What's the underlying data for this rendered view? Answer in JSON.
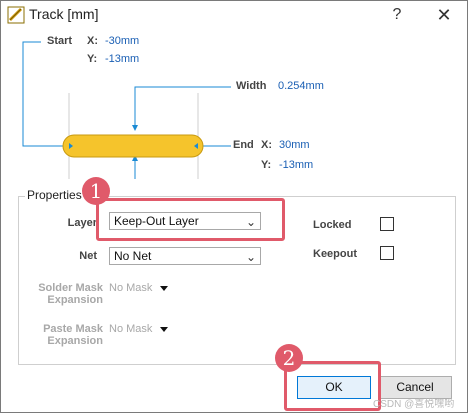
{
  "window": {
    "title": "Track [mm]",
    "help_glyph": "?",
    "close_glyph": "✕"
  },
  "diagram": {
    "start_label": "Start",
    "start_x_label": "X:",
    "start_x_value": "-30mm",
    "start_y_label": "Y:",
    "start_y_value": "-13mm",
    "width_label": "Width",
    "width_value": "0.254mm",
    "end_label": "End",
    "end_x_label": "X:",
    "end_x_value": "30mm",
    "end_y_label": "Y:",
    "end_y_value": "-13mm",
    "track_color": "#f5c42c",
    "accent_color": "#1a8ad4"
  },
  "properties": {
    "group_title": "Properties",
    "layer_label": "Layer",
    "layer_value": "Keep-Out Layer",
    "net_label": "Net",
    "net_value": "No Net",
    "locked_label": "Locked",
    "locked_checked": false,
    "keepout_label": "Keepout",
    "keepout_checked": false,
    "solder_mask_label_1": "Solder Mask",
    "solder_mask_label_2": "Expansion",
    "solder_mask_value": "No Mask",
    "paste_mask_label_1": "Paste Mask",
    "paste_mask_label_2": "Expansion",
    "paste_mask_value": "No Mask"
  },
  "buttons": {
    "ok": "OK",
    "cancel": "Cancel"
  },
  "annotations": {
    "badge_1": "1",
    "badge_2": "2",
    "color": "#e05a6a"
  },
  "watermark": "CSDN @喜悦嘿哟"
}
